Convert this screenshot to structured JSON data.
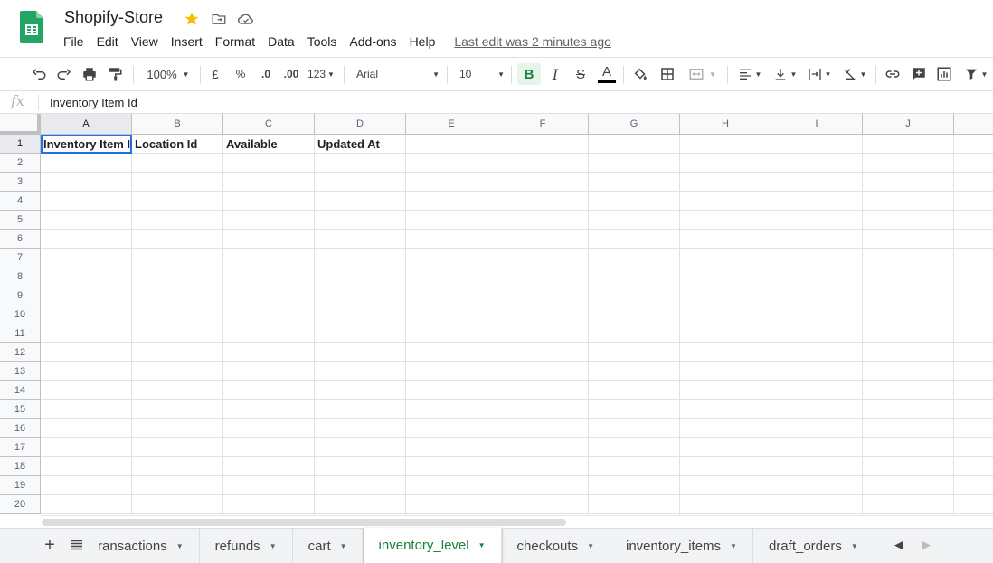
{
  "header": {
    "title": "Shopify-Store",
    "menu": [
      "File",
      "Edit",
      "View",
      "Insert",
      "Format",
      "Data",
      "Tools",
      "Add-ons",
      "Help"
    ],
    "last_edit": "Last edit was 2 minutes ago",
    "star_color": "#fbbc04"
  },
  "toolbar": {
    "zoom": "100%",
    "currency": "£",
    "percent": "%",
    "decrease_decimal": ".0",
    "increase_decimal": ".00",
    "more_formats": "123",
    "font": "Arial",
    "font_size": "10",
    "bold": "B",
    "italic": "I",
    "strike": "S",
    "text_color": "A"
  },
  "formula_bar": {
    "fx": "fx",
    "value": "Inventory Item Id"
  },
  "grid": {
    "columns": [
      "A",
      "B",
      "C",
      "D",
      "E",
      "F",
      "G",
      "H",
      "I",
      "J"
    ],
    "rows": [
      "1",
      "2",
      "3",
      "4",
      "5",
      "6",
      "7",
      "8",
      "9",
      "10",
      "11",
      "12",
      "13",
      "14",
      "15",
      "16",
      "17",
      "18",
      "19",
      "20"
    ],
    "header_row": [
      "Inventory Item Id",
      "Location Id",
      "Available",
      "Updated At"
    ],
    "active_cell": "A1"
  },
  "sheets": {
    "tabs": [
      "ransactions",
      "refunds",
      "cart",
      "inventory_level",
      "checkouts",
      "inventory_items",
      "draft_orders"
    ],
    "active": "inventory_level",
    "accent": "#188038"
  }
}
